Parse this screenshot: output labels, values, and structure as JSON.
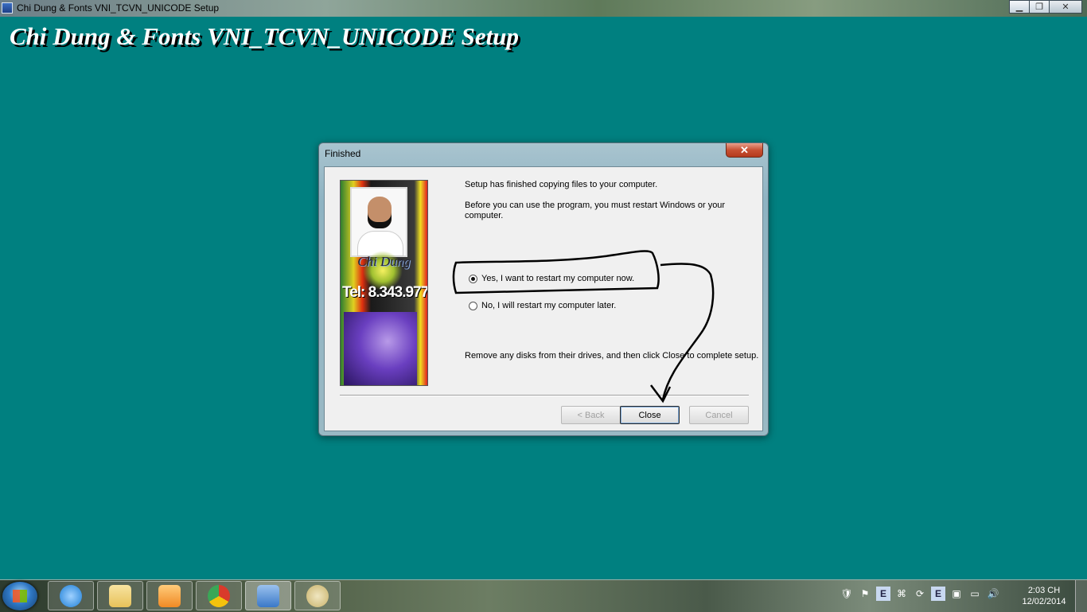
{
  "window": {
    "title": "Chi Dung & Fonts VNI_TCVN_UNICODE Setup",
    "minimize_glyph": "▁",
    "restore_glyph": "❐",
    "close_glyph": "✕"
  },
  "banner": {
    "text": "Chi Dung & Fonts VNI_TCVN_UNICODE Setup"
  },
  "dialog": {
    "title": "Finished",
    "close_glyph": "✕",
    "logo": {
      "name": "Chi Dung",
      "tel": "Tel: 8.343.977"
    },
    "line1": "Setup has finished copying files to your computer.",
    "line2": "Before you can use the program, you must restart Windows or your computer.",
    "options": [
      {
        "label": "Yes, I want to restart my computer now.",
        "checked": true
      },
      {
        "label": "No, I will restart my computer later.",
        "checked": false
      }
    ],
    "footer_text": "Remove any disks from their drives, and then click Close to complete setup.",
    "buttons": {
      "back": "< Back",
      "close": "Close",
      "cancel": "Cancel"
    }
  },
  "taskbar": {
    "items": [
      {
        "name": "internet-explorer-icon",
        "color": "#1e7fd6"
      },
      {
        "name": "windows-explorer-icon",
        "color": "#e8c25a"
      },
      {
        "name": "media-player-icon",
        "color": "#f08a24"
      },
      {
        "name": "chrome-icon",
        "color": "#d93a2b"
      },
      {
        "name": "setup-program-icon",
        "color": "#3a78c8"
      },
      {
        "name": "paint-icon",
        "color": "#c8b26a"
      }
    ],
    "tray_icons": [
      "security-icon",
      "flag-icon",
      "e-icon",
      "network-manager-icon",
      "sync-icon",
      "e-icon",
      "device-icon",
      "display-icon",
      "volume-icon"
    ],
    "clock": {
      "time": "2:03 CH",
      "date": "12/02/2014"
    }
  }
}
